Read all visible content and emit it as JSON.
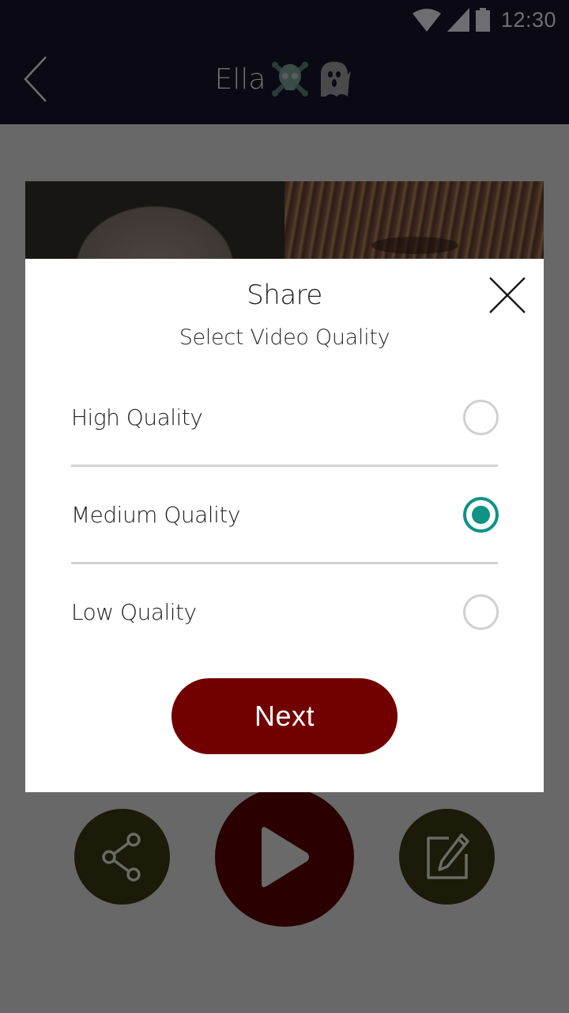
{
  "status_bar": {
    "time": "12:30",
    "icons": [
      "wifi-icon",
      "cell-signal-icon",
      "battery-icon"
    ]
  },
  "app_bar": {
    "title": "Ella",
    "title_emojis": [
      "skull-crossbones-icon",
      "ghost-icon"
    ],
    "back_icon": "chevron-left-icon"
  },
  "actions": {
    "share_icon": "share-icon",
    "play_icon": "play-icon",
    "edit_icon": "edit-icon"
  },
  "dialog": {
    "title": "Share",
    "subtitle": "Select Video Quality",
    "close_icon": "close-icon",
    "options": [
      {
        "label": "High Quality",
        "selected": false
      },
      {
        "label": "Medium Quality",
        "selected": true
      },
      {
        "label": "Low Quality",
        "selected": false
      }
    ],
    "next_label": "Next"
  },
  "colors": {
    "accent_radio": "#0e9384",
    "primary_button": "#720000",
    "scrim": "#686868",
    "top_bar": "#0b0a14"
  }
}
